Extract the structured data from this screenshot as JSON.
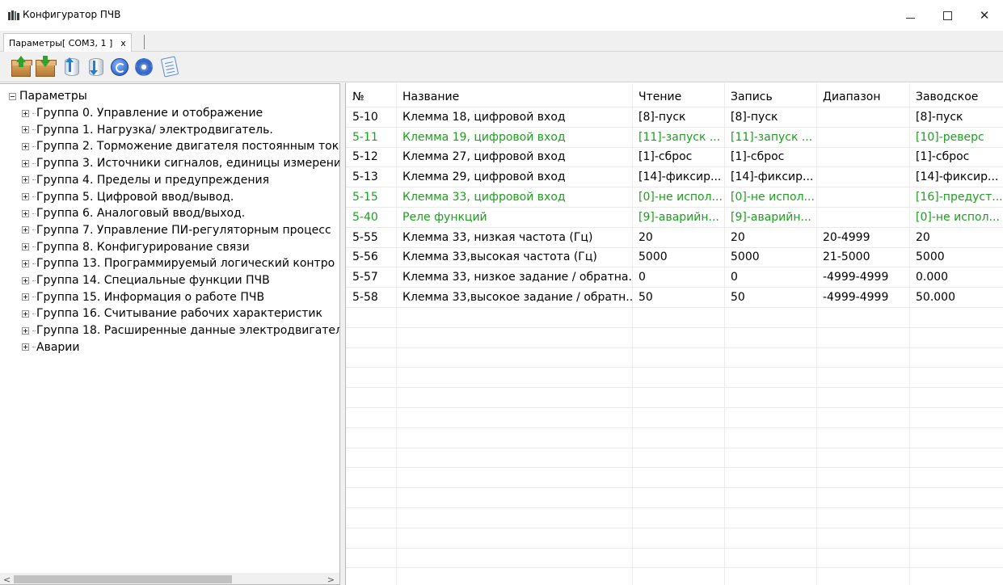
{
  "window": {
    "title": "Конфигуратор ПЧВ"
  },
  "tabs": [
    {
      "label": "Параметры[ COM3, 1 ]",
      "close": "x"
    }
  ],
  "toolbar": {
    "buttons": [
      {
        "name": "upload-box-icon"
      },
      {
        "name": "download-box-icon"
      },
      {
        "name": "db-upload-icon"
      },
      {
        "name": "db-download-icon"
      },
      {
        "name": "refresh-icon"
      },
      {
        "name": "gear-icon"
      },
      {
        "name": "document-icon"
      }
    ]
  },
  "tree": {
    "root": "Параметры",
    "items": [
      "Группа 0. Управление и отображение",
      "Группа 1. Нагрузка/ электродвигатель.",
      "Группа 2. Торможение двигателя постоянным ток",
      "Группа 3. Источники сигналов, единицы измерени",
      "Группа 4. Пределы и предупреждения",
      "Группа 5. Цифровой ввод/вывод.",
      "Группа 6. Аналоговый ввод/выход.",
      "Группа 7. Управление ПИ-регуляторным процесс",
      "Группа 8. Конфигурирование связи",
      "Группа 13. Программируемый логический контро",
      "Группа 14. Специальные функции ПЧВ",
      "Группа 15. Информация о работе ПЧВ",
      "Группа 16. Считывание рабочих характеристик",
      "Группа 18. Расширенные данные электродвигател",
      "Аварии"
    ],
    "scroll_left": "<",
    "scroll_right": ">"
  },
  "grid": {
    "headers": [
      "№",
      "Название",
      "Чтение",
      "Запись",
      "Диапазон",
      "Заводское"
    ],
    "rows": [
      {
        "no": "5-10",
        "name": "Клемма 18, цифровой вход",
        "read": "[8]-пуск",
        "write": "[8]-пуск",
        "range": "",
        "factory": "[8]-пуск",
        "changed": false
      },
      {
        "no": "5-11",
        "name": "Клемма 19, цифровой вход",
        "read": "[11]-запуск ...",
        "write": "[11]-запуск ...",
        "range": "",
        "factory": "[10]-реверс",
        "changed": true
      },
      {
        "no": "5-12",
        "name": "Клемма 27, цифровой вход",
        "read": "[1]-сброс",
        "write": "[1]-сброс",
        "range": "",
        "factory": "[1]-сброс",
        "changed": false
      },
      {
        "no": "5-13",
        "name": "Клемма 29, цифровой вход",
        "read": "[14]-фиксир...",
        "write": "[14]-фиксир...",
        "range": "",
        "factory": "[14]-фиксир...",
        "changed": false
      },
      {
        "no": "5-15",
        "name": "Клемма 33, цифровой вход",
        "read": "[0]-не испол...",
        "write": "[0]-не испол...",
        "range": "",
        "factory": "[16]-предуст...",
        "changed": true
      },
      {
        "no": "5-40",
        "name": "Реле функций",
        "read": "[9]-аварийн...",
        "write": "[9]-аварийн...",
        "range": "",
        "factory": "[0]-не испол...",
        "changed": true
      },
      {
        "no": "5-55",
        "name": "Клемма 33, низкая частота (Гц)",
        "read": "20",
        "write": "20",
        "range": "20-4999",
        "factory": "20",
        "changed": false
      },
      {
        "no": "5-56",
        "name": "Клемма 33,высокая частота (Гц)",
        "read": "5000",
        "write": "5000",
        "range": "21-5000",
        "factory": "5000",
        "changed": false
      },
      {
        "no": "5-57",
        "name": "Клемма 33, низкое задание / обратна...",
        "read": "0",
        "write": "0",
        "range": "-4999-4999",
        "factory": "0.000",
        "changed": false
      },
      {
        "no": "5-58",
        "name": "Клемма 33,высокое задание / обратн...",
        "read": "50",
        "write": "50",
        "range": "-4999-4999",
        "factory": "50.000",
        "changed": false
      }
    ],
    "changed_color": "#1e9e1e"
  }
}
